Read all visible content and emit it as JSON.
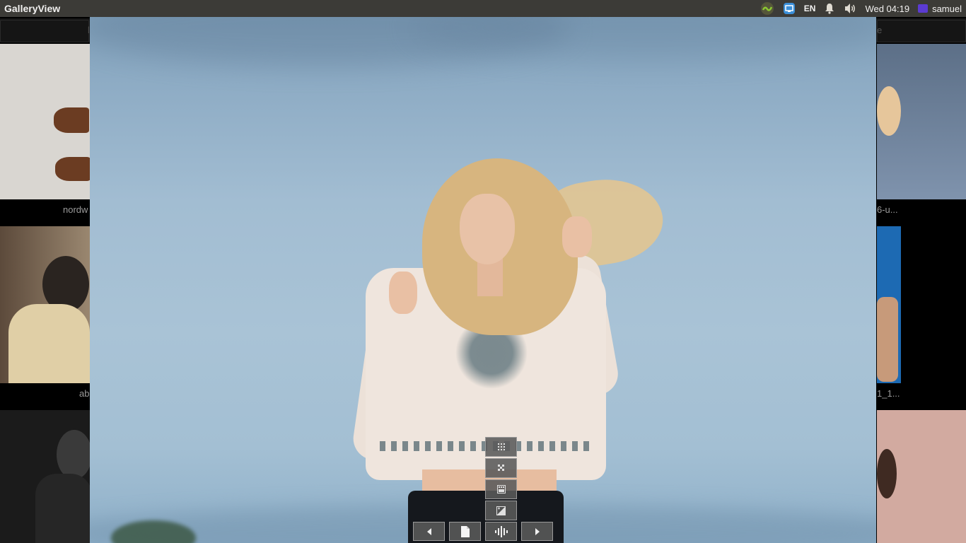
{
  "topbar": {
    "app_title": "GalleryView",
    "indicators": [
      {
        "name": "app-indicator-icon"
      },
      {
        "name": "display-icon"
      },
      {
        "name": "keyboard-layout",
        "label": "EN"
      },
      {
        "name": "notification-bell-icon"
      },
      {
        "name": "volume-icon"
      }
    ],
    "keyboard_label": "EN",
    "clock": "Wed 04:19",
    "username": "samuel",
    "colors": {
      "panel": "#3c3b37",
      "indicator_green": "#8cc832",
      "indicator_blue": "#3b8fd8",
      "avatar": "#5b3bd1"
    }
  },
  "gallery": {
    "captions": {
      "left_top": "nordw",
      "left_middle": "ab",
      "right_top": "6-u...",
      "right_middle": "1_1..."
    },
    "toolbar_fragments": {
      "left": "l",
      "right": "e"
    }
  },
  "viewer": {
    "image_subject": "woman-blonde-embroidered-blouse-sky",
    "controls": {
      "zoom_actual": "zoom-actual-icon",
      "zoom_fit": "zoom-fit-icon",
      "filmstrip": "filmstrip-icon",
      "adjust": "brightness-contrast-icon",
      "prev": "previous-icon",
      "info": "document-icon",
      "audio": "waveform-icon",
      "next": "next-icon"
    },
    "colors": {
      "sky": "#a9c3d6",
      "control_bg": "#5a5a5a"
    }
  }
}
